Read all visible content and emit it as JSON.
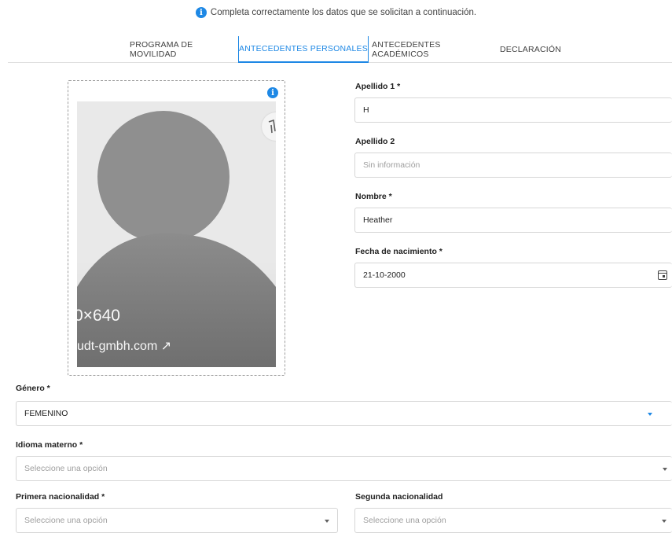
{
  "notice": {
    "icon": "info-icon",
    "text": "Completa correctamente los datos que se solicitan a continuación."
  },
  "tabs": [
    {
      "label": "PROGRAMA DE MOVILIDAD",
      "active": false
    },
    {
      "label": "ANTECEDENTES PERSONALES",
      "active": true
    },
    {
      "label": "ANTECEDENTES ACADÉMICOS",
      "active": false
    },
    {
      "label": "DECLARACIÓN",
      "active": false
    }
  ],
  "photo": {
    "info_icon": "info-icon",
    "dimension_text": "0×640",
    "site_text": "udt-gmbh.com ↗",
    "crop_icon": "crop-icon"
  },
  "form": {
    "apellido1": {
      "label": "Apellido 1 *",
      "value": "H"
    },
    "apellido2": {
      "label": "Apellido 2",
      "placeholder": "Sin información"
    },
    "nombre": {
      "label": "Nombre *",
      "value": "Heather"
    },
    "fecha": {
      "label": "Fecha de nacimiento *",
      "value": "21-10-2000",
      "icon": "calendar-icon"
    },
    "genero": {
      "label": "Género *",
      "value": "FEMENINO"
    },
    "idioma": {
      "label": "Idioma materno *",
      "placeholder": "Seleccione una opción"
    },
    "nacionalidad1": {
      "label": "Primera nacionalidad *",
      "placeholder": "Seleccione una opción"
    },
    "nacionalidad2": {
      "label": "Segunda nacionalidad",
      "placeholder": "Seleccione una opción"
    }
  },
  "colors": {
    "accent": "#1e88e5",
    "border": "#d6d6d6",
    "placeholder": "#9e9e9e"
  }
}
